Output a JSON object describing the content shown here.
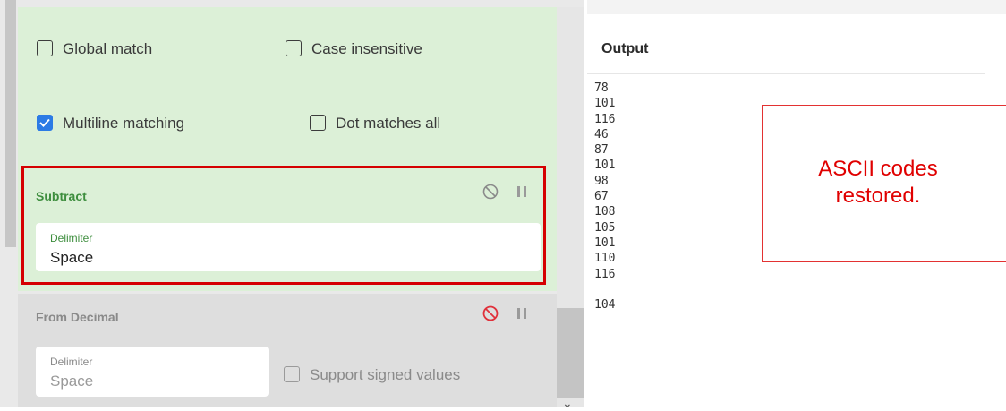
{
  "options": {
    "global_match": {
      "label": "Global match",
      "checked": false
    },
    "case_insensitive": {
      "label": "Case insensitive",
      "checked": false
    },
    "multiline": {
      "label": "Multiline matching",
      "checked": true
    },
    "dot_all": {
      "label": "Dot matches all",
      "checked": false
    }
  },
  "subtract": {
    "title": "Subtract",
    "delimiter_label": "Delimiter",
    "delimiter_value": "Space",
    "disable_icon": "disable-circle-icon",
    "pause_icon": "pause-icon"
  },
  "from_decimal": {
    "title": "From Decimal",
    "delimiter_label": "Delimiter",
    "delimiter_value": "Space",
    "signed_label": "Support signed values",
    "signed_checked": false,
    "disable_icon": "disable-circle-icon",
    "pause_icon": "pause-icon"
  },
  "output": {
    "title": "Output",
    "lines": [
      "78",
      "101",
      "116",
      "46",
      "87",
      "101",
      "98",
      "67",
      "108",
      "105",
      "101",
      "110",
      "116",
      "",
      "104"
    ]
  },
  "annotation": {
    "text_line1": "ASCII codes",
    "text_line2": "restored."
  },
  "colors": {
    "accent_green": "#3e8e3e",
    "highlight_red": "#d50000",
    "checkbox_blue": "#2c7be5",
    "disabled_red": "#e0303a"
  }
}
